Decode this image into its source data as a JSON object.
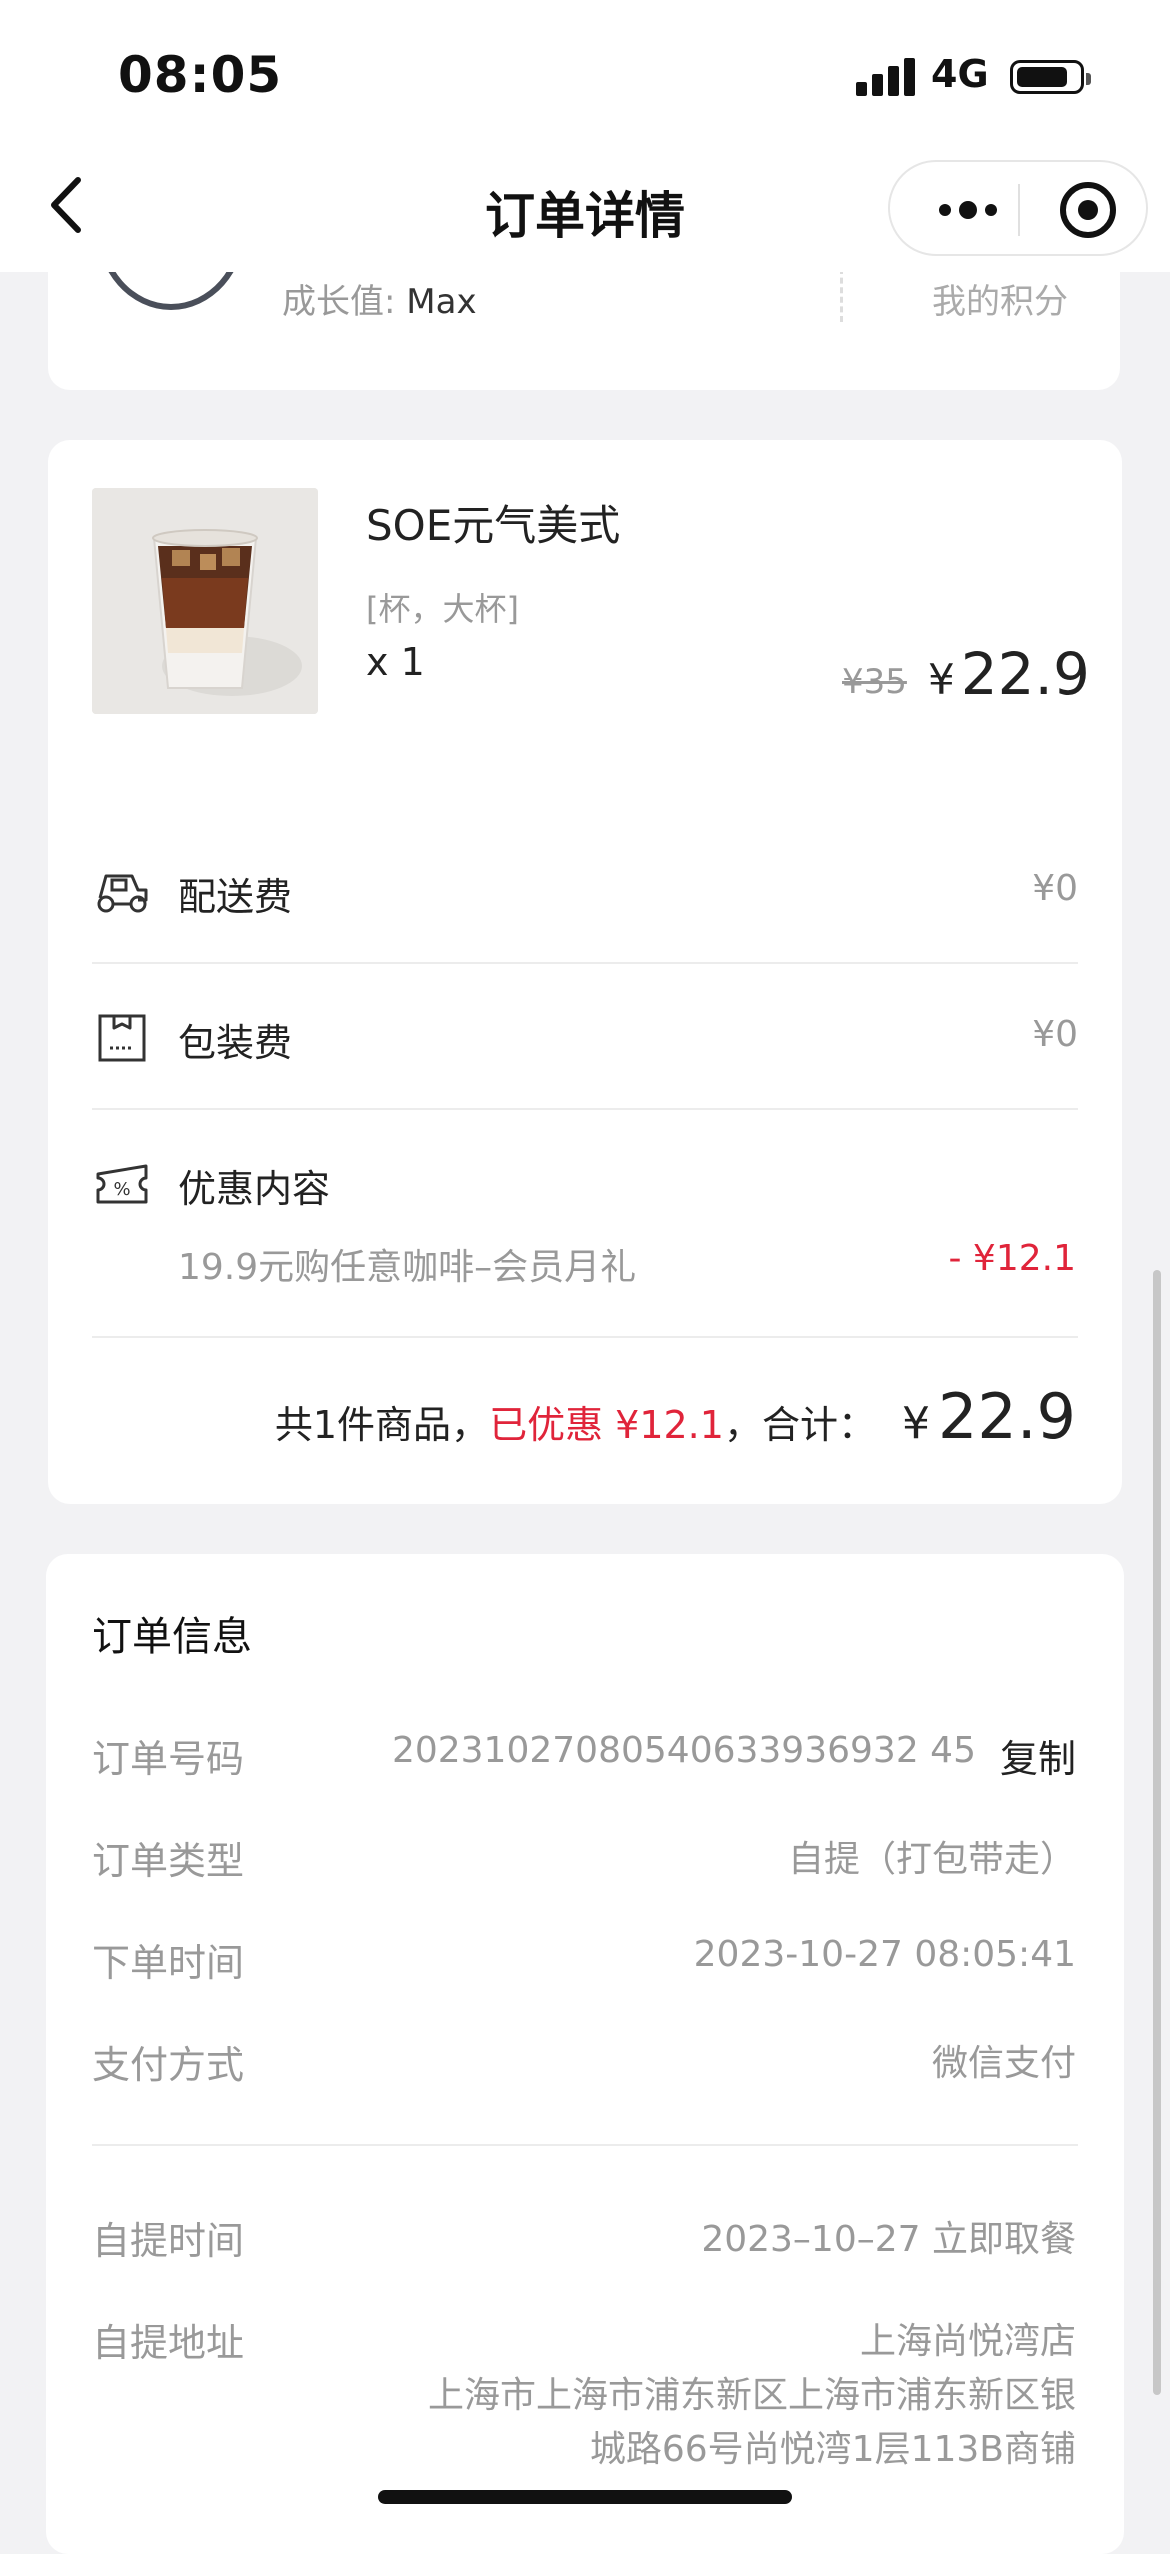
{
  "status_bar": {
    "time": "08:05",
    "network": "4G"
  },
  "nav": {
    "title": "订单详情"
  },
  "member": {
    "growth_label": "成长值:",
    "growth_value": "Max",
    "points_label": "我的积分"
  },
  "product": {
    "name": "SOE元气美式",
    "spec": "[杯，大杯]",
    "qty": "x 1",
    "original_price": "¥35",
    "price_symbol": "¥",
    "price": "22.9"
  },
  "fees": {
    "delivery": {
      "label": "配送费",
      "value": "¥0",
      "icon": "scooter-icon"
    },
    "packaging": {
      "label": "包装费",
      "value": "¥0",
      "icon": "package-box-icon"
    },
    "discount": {
      "label": "优惠内容",
      "icon": "coupon-icon",
      "desc": "19.9元购任意咖啡–会员月礼",
      "amount": "- ¥12.1"
    }
  },
  "summary": {
    "count_text": "共1件商品，",
    "saved_text": "已优惠 ¥12.1",
    "total_label": "，合计：",
    "total_symbol": "¥",
    "total_value": "22.9"
  },
  "order_info": {
    "title": "订单信息",
    "order_no_label": "订单号码",
    "order_no": "20231027080540633936932 45",
    "copy_label": "复制",
    "type_label": "订单类型",
    "type": "自提（打包带走）",
    "time_label": "下单时间",
    "time": "2023-10-27 08:05:41",
    "pay_label": "支付方式",
    "pay": "微信支付",
    "pickup_time_label": "自提时间",
    "pickup_time": "2023–10–27 立即取餐",
    "pickup_addr_label": "自提地址",
    "pickup_store": "上海尚悦湾店",
    "pickup_addr_line1": "上海市上海市浦东新区上海市浦东新区银",
    "pickup_addr_line2": "城路66号尚悦湾1层113B商铺"
  },
  "colors": {
    "accent_red": "#e0243a",
    "muted": "#999999",
    "background": "#f2f2f4"
  }
}
